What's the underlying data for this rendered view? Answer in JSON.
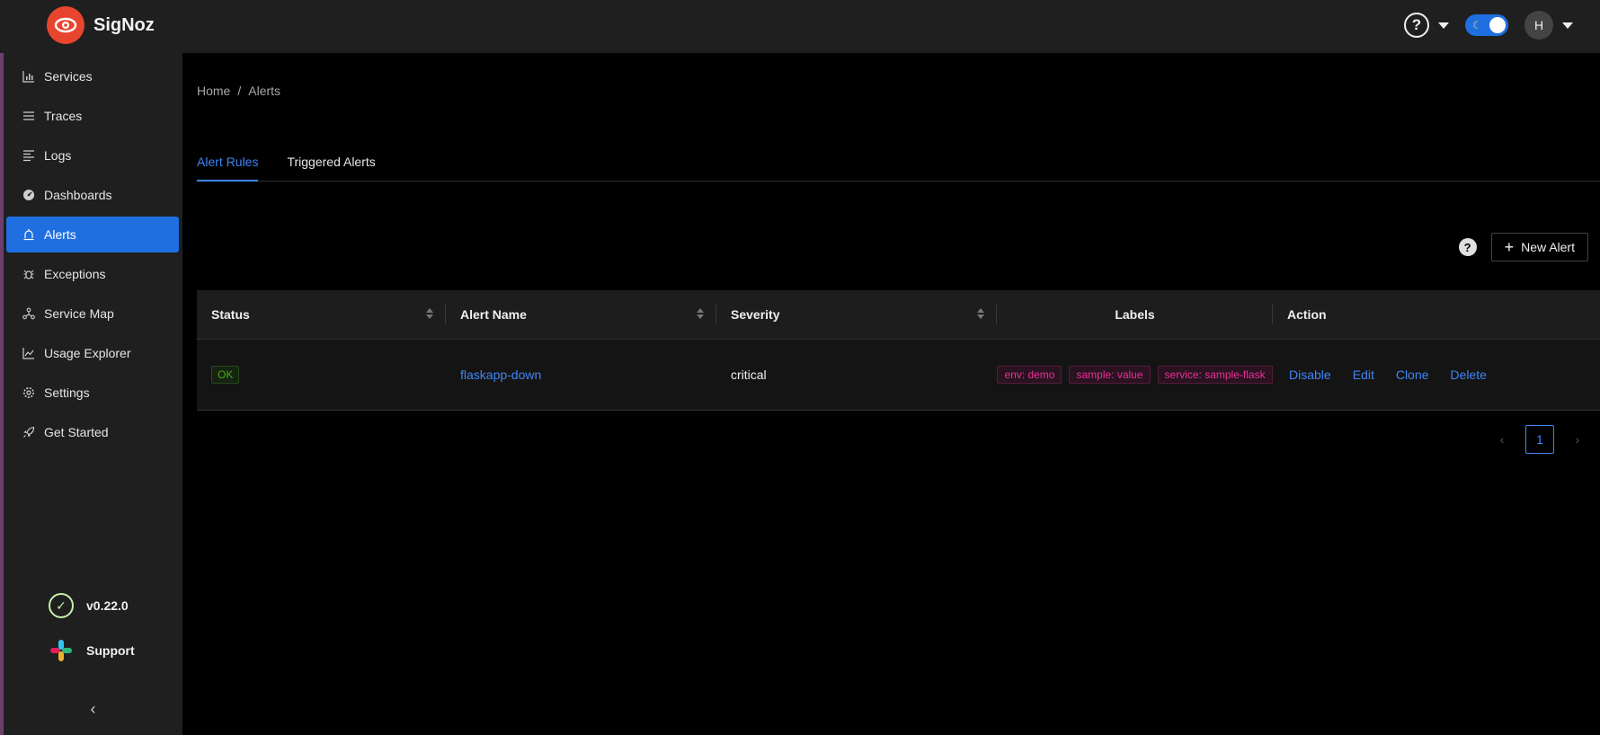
{
  "brand": {
    "name": "SigNoz"
  },
  "header": {
    "avatar_initial": "H"
  },
  "sidebar": {
    "items": [
      {
        "label": "Services",
        "icon": "bar-chart-icon"
      },
      {
        "label": "Traces",
        "icon": "menu-icon"
      },
      {
        "label": "Logs",
        "icon": "align-left-icon"
      },
      {
        "label": "Dashboards",
        "icon": "dashboard-icon"
      },
      {
        "label": "Alerts",
        "icon": "alert-icon",
        "active": true
      },
      {
        "label": "Exceptions",
        "icon": "bug-icon"
      },
      {
        "label": "Service Map",
        "icon": "deployment-unit-icon"
      },
      {
        "label": "Usage Explorer",
        "icon": "line-chart-icon"
      },
      {
        "label": "Settings",
        "icon": "gear-icon"
      },
      {
        "label": "Get Started",
        "icon": "rocket-icon"
      }
    ],
    "version": "v0.22.0",
    "support_label": "Support"
  },
  "breadcrumb": {
    "home": "Home",
    "separator": "/",
    "current": "Alerts"
  },
  "tabs": [
    {
      "label": "Alert Rules",
      "active": true
    },
    {
      "label": "Triggered Alerts",
      "active": false
    }
  ],
  "toolbar": {
    "new_alert_label": "New Alert"
  },
  "table": {
    "columns": {
      "status": "Status",
      "name": "Alert Name",
      "severity": "Severity",
      "labels": "Labels",
      "action": "Action"
    },
    "rows": [
      {
        "status": "OK",
        "name": "flaskapp-down",
        "severity": "critical",
        "labels": [
          "env: demo",
          "sample: value",
          "service: sample-flask"
        ],
        "actions": [
          "Disable",
          "Edit",
          "Clone",
          "Delete"
        ]
      }
    ]
  },
  "pagination": {
    "current_page": "1"
  },
  "colors": {
    "accent": "#1f6fe0",
    "link": "#3f85f5",
    "ok": "#49aa19",
    "label": "#eb2f96"
  }
}
